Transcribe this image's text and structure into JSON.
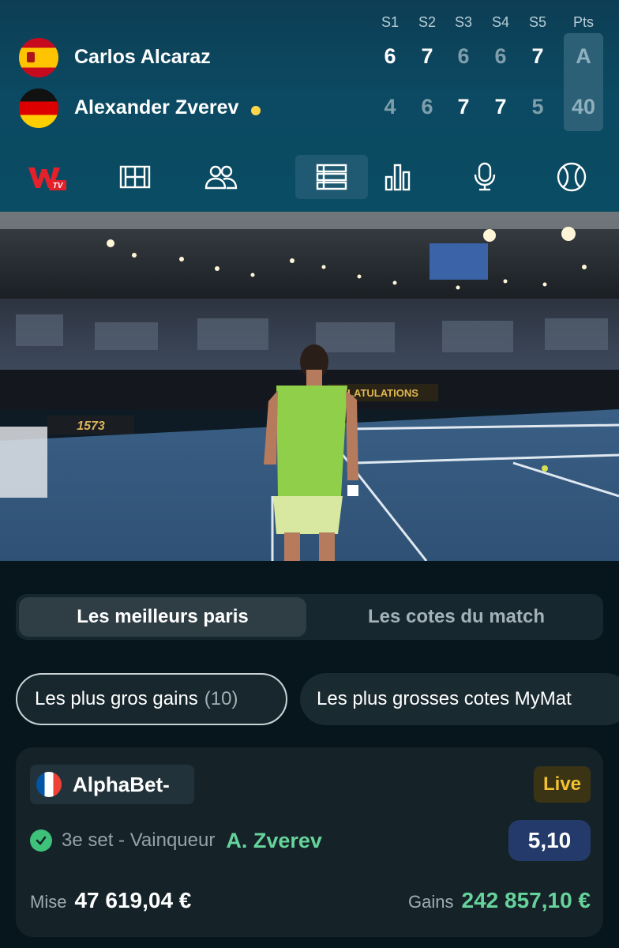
{
  "scoreboard": {
    "set_headers": [
      "S1",
      "S2",
      "S3",
      "S4",
      "S5"
    ],
    "points_header": "Pts",
    "players": [
      {
        "name": "Carlos Alcaraz",
        "flag": "spain-flag-icon",
        "serving": false,
        "sets": [
          "6",
          "7",
          "6",
          "6",
          "7"
        ],
        "set_won": [
          true,
          true,
          false,
          false,
          true
        ],
        "points": "A"
      },
      {
        "name": "Alexander Zverev",
        "flag": "germany-flag-icon",
        "serving": true,
        "sets": [
          "4",
          "6",
          "7",
          "7",
          "5"
        ],
        "set_won": [
          false,
          false,
          true,
          true,
          false
        ],
        "points": "40"
      }
    ],
    "colors": {
      "serve_indicator": "#ffd54a",
      "winning_score": "#ffffff",
      "losing_score": "#7f9eab"
    }
  },
  "nav": {
    "active_index": 3,
    "items": [
      {
        "icon": "w-tv-logo-icon",
        "badge": "TV"
      },
      {
        "icon": "tennis-court-icon"
      },
      {
        "icon": "players-icon"
      },
      {
        "icon": "bets-list-icon"
      },
      {
        "icon": "stats-bar-chart-icon"
      },
      {
        "icon": "microphone-icon"
      },
      {
        "icon": "tennis-ball-icon"
      }
    ]
  },
  "video": {
    "banner_text": "LATULATIONS",
    "sponsor_text": "1573"
  },
  "tabs": {
    "active": "Les meilleurs paris",
    "inactive": "Les cotes du match"
  },
  "filters": {
    "active_label": "Les plus gros gains",
    "active_count": "(10)",
    "other_label": "Les plus grosses cotes MyMat"
  },
  "bet": {
    "bookmaker": "AlphaBet-",
    "bookmaker_flag": "france-flag-icon",
    "live_label": "Live",
    "market": "3e set - Vainqueur",
    "selection": "A. Zverev",
    "odds": "5,10",
    "stake_label": "Mise",
    "stake_value": "47 619,04 €",
    "gain_label": "Gains",
    "gain_value": "242 857,10 €",
    "colors": {
      "win_green": "#66d39b",
      "live_yellow": "#f2c230",
      "odds_bg": "#243a6a"
    }
  }
}
